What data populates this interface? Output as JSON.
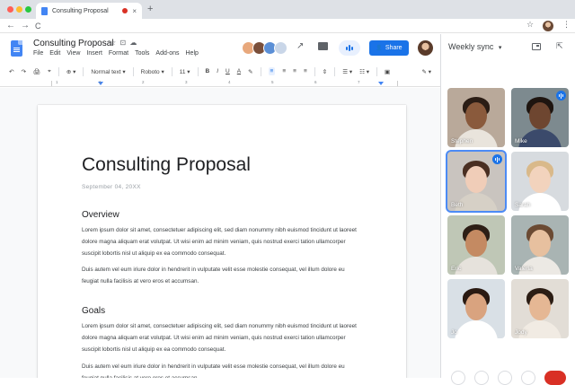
{
  "browser": {
    "tab_title": "Consulting Proposal",
    "tab_close": "×",
    "new_tab": "+",
    "nav": {
      "back": "←",
      "forward": "→",
      "reload": "C"
    },
    "star": "☆",
    "kebab": "⋮",
    "traffic_colors": [
      "#ff5f57",
      "#febc2e",
      "#28c840"
    ]
  },
  "docs": {
    "title": "Consulting Proposal",
    "title_icons": "☆ ⊡ ☁",
    "menu": [
      "File",
      "Edit",
      "View",
      "Insert",
      "Format",
      "Tools",
      "Add-ons",
      "Help"
    ],
    "share_label": "Share",
    "share_icon": "👤",
    "trend_icon": "↗",
    "accent": "#1a73e8"
  },
  "toolbar": {
    "undo": "↶",
    "redo": "↷",
    "print": "🖨",
    "paint": "⌖",
    "zoom": "⊕ ▾",
    "style": "Normal text ▾",
    "font": "Roboto ▾",
    "size": "11 ▾",
    "bold": "B",
    "italic": "I",
    "underline": "U",
    "text_color": "A",
    "highlight": "✎",
    "link": "⌬",
    "comment": "▭",
    "image": "▣",
    "align_left": "≡",
    "align_center": "≡",
    "align_right": "≡",
    "align_justify": "≡",
    "line_spacing": "⇕",
    "bullets": "☰ ▾",
    "numbers": "☷ ▾",
    "indent": "⇥",
    "edit_mode": "✎ ▾"
  },
  "ruler": [
    "1",
    "1",
    "2",
    "3",
    "4",
    "5",
    "6",
    "7"
  ],
  "document": {
    "heading": "Consulting Proposal",
    "date": "September 04, 20XX",
    "overview_heading": "Overview",
    "overview_p1": "Lorem ipsum dolor sit amet, consectetuer adipiscing elit, sed diam nonummy nibh euismod tincidunt ut laoreet dolore magna aliquam erat volutpat. Ut wisi enim ad minim veniam, quis nostrud exerci tation ullamcorper suscipit lobortis nisl ut aliquip ex ea commodo consequat.",
    "overview_p2": "Duis autem vel eum iriure dolor in hendrerit in vulputate velit esse molestie consequat, vel illum dolore eu feugiat nulla facilisis at vero eros et accumsan.",
    "goals_heading": "Goals",
    "goals_p1": "Lorem ipsum dolor sit amet, consectetuer adipiscing elit, sed diam nonummy nibh euismod tincidunt ut laoreet dolore magna aliquam erat volutpat. Ut wisi enim ad minim veniam, quis nostrud exerci tation ullamcorper suscipit lobortis nisl ut aliquip ex ea commodo consequat.",
    "goals_p2": "Duis autem vel eum iriure dolor in hendrerit in vulputate velit esse molestie consequat, vel illum dolore eu feugiat nulla facilisis at vero eros et accumsan."
  },
  "meet": {
    "title": "Weekly sync",
    "dropdown": "▾",
    "open_icon": "⇱",
    "participants": [
      {
        "name": "Stephen",
        "speaking": false,
        "highlight": false,
        "bg": "#b9a99a",
        "skin": "#8a5a3c",
        "hair": "#2b1d15",
        "shirt": "#e9e4dc"
      },
      {
        "name": "Mike",
        "speaking": true,
        "highlight": false,
        "bg": "#7d8a8f",
        "skin": "#6e4630",
        "hair": "#1e1510",
        "shirt": "#3b4a6b"
      },
      {
        "name": "Beth",
        "speaking": true,
        "highlight": true,
        "bg": "#c9c4bf",
        "skin": "#f0cdb8",
        "hair": "#4a2f22",
        "shirt": "#d6d0c6"
      },
      {
        "name": "Sarah",
        "speaking": false,
        "highlight": false,
        "bg": "#d7dbdf",
        "skin": "#f2d3bd",
        "hair": "#d9b98a",
        "shirt": "#ffffff"
      },
      {
        "name": "Eric",
        "speaking": false,
        "highlight": false,
        "bg": "#bfc7b6",
        "skin": "#c48a62",
        "hair": "#2e1f16",
        "shirt": "#e6e2dc"
      },
      {
        "name": "Valeria",
        "speaking": false,
        "highlight": false,
        "bg": "#a9b4b3",
        "skin": "#e7c09f",
        "hair": "#6b4a33",
        "shirt": "#ece9e4"
      },
      {
        "name": "Jo",
        "speaking": false,
        "highlight": false,
        "bg": "#d9e0e6",
        "skin": "#d9a37f",
        "hair": "#2a1a12",
        "shirt": "#ffffff"
      },
      {
        "name": "Jody",
        "speaking": false,
        "highlight": false,
        "bg": "#e2ddd6",
        "skin": "#e5b794",
        "hair": "#2c1d14",
        "shirt": "#f1ebe3"
      }
    ]
  },
  "collaborator_colors": [
    "#e8a87c",
    "#7a4f3a",
    "#5b8fd6",
    "#c9d6e8"
  ]
}
